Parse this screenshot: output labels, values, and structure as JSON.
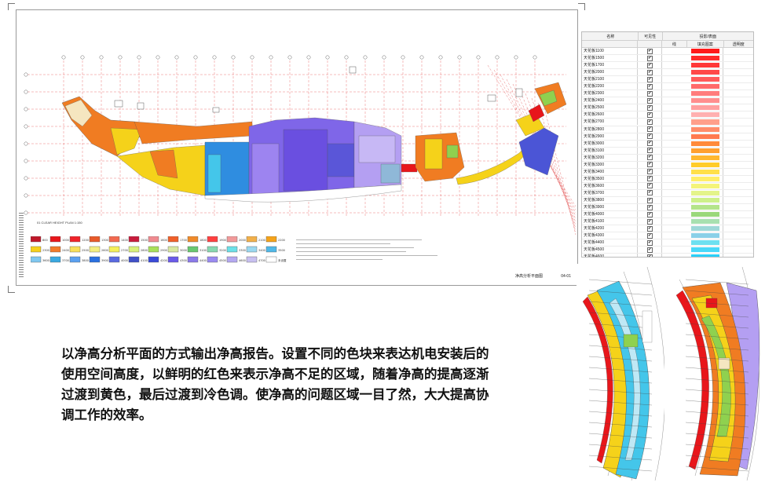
{
  "sheet": {
    "sub_title": "01 CLEAR HEIGHT PLAN 1:150",
    "title": "净高分析平面图",
    "number": "04-01"
  },
  "plan_colors": {
    "red": "#e8161b",
    "orange": "#f07c22",
    "yellow": "#f5d21a",
    "green": "#8fd14f",
    "cyan": "#44c6ea",
    "blue": "#2f6fe0",
    "indigo": "#4b55d6",
    "violet": "#7f66e8",
    "lavender": "#b49ff2"
  },
  "legend_swatches": [
    {
      "color": "#c0182a",
      "label": "800"
    },
    {
      "color": "#e8161b",
      "label": "1000"
    },
    {
      "color": "#f0242a",
      "label": "1200"
    },
    {
      "color": "#e85a2a",
      "label": "1300"
    },
    {
      "color": "#f26a50",
      "label": "1400"
    },
    {
      "color": "#c81c3c",
      "label": "1500"
    },
    {
      "color": "#f08a90",
      "label": "1600"
    },
    {
      "color": "#f0602a",
      "label": "1700"
    },
    {
      "color": "#f08a2a",
      "label": "1800"
    },
    {
      "color": "#ff4040",
      "label": "1900"
    },
    {
      "color": "#f29a9a",
      "label": "2000"
    },
    {
      "color": "#f2b04a",
      "label": "2100"
    },
    {
      "color": "#f5a31a",
      "label": "2200"
    },
    {
      "color": "#f7d01c",
      "label": "2300"
    },
    {
      "color": "#f27a2a",
      "label": "2400"
    },
    {
      "color": "#f8e05a",
      "label": "2500"
    },
    {
      "color": "#f3ee80",
      "label": "2600"
    },
    {
      "color": "#f5f05a",
      "label": "2700"
    },
    {
      "color": "#d8f07a",
      "label": "2800"
    },
    {
      "color": "#a8e05a",
      "label": "2900"
    },
    {
      "color": "#d8e8a0",
      "label": "3000"
    },
    {
      "color": "#68c870",
      "label": "3100"
    },
    {
      "color": "#88d8b0",
      "label": "3200"
    },
    {
      "color": "#6ce0e8",
      "label": "3300"
    },
    {
      "color": "#9ad8f0",
      "label": "3400"
    },
    {
      "color": "#50b8e8",
      "label": "3500"
    },
    {
      "color": "#80c8f0",
      "label": "3600"
    },
    {
      "color": "#3aa8e0",
      "label": "3700"
    },
    {
      "color": "#5aa0f0",
      "label": "3800"
    },
    {
      "color": "#2a70e0",
      "label": "3900"
    },
    {
      "color": "#5a6ae0",
      "label": "4000"
    },
    {
      "color": "#4050c8",
      "label": "4100"
    },
    {
      "color": "#3a4ad8",
      "label": "4200"
    },
    {
      "color": "#6a5ae8",
      "label": "4300"
    },
    {
      "color": "#8a7ae8",
      "label": "4400"
    },
    {
      "color": "#9a8af0",
      "label": "4500"
    },
    {
      "color": "#b4a8f0",
      "label": "4600"
    },
    {
      "color": "#c8c0f0",
      "label": "4700"
    },
    {
      "color": "#ffffff",
      "label": "未设置"
    }
  ],
  "view_graphics": {
    "headers": {
      "name": "名称",
      "visible": "可见性",
      "group": "投影/表面",
      "line": "线",
      "fill": "填充图案",
      "transparency": "透明度"
    },
    "rows": [
      {
        "name": "天花板1100",
        "visible": true,
        "color": "#ff1a1a"
      },
      {
        "name": "天花板1500",
        "visible": true,
        "color": "#ff2a2a"
      },
      {
        "name": "天花板1700",
        "visible": true,
        "color": "#ff3838"
      },
      {
        "name": "天花板2000",
        "visible": true,
        "color": "#ff4848"
      },
      {
        "name": "天花板2100",
        "visible": true,
        "color": "#ff5a5a"
      },
      {
        "name": "天花板2200",
        "visible": true,
        "color": "#ff6a6a"
      },
      {
        "name": "天花板2300",
        "visible": true,
        "color": "#ff7c7c"
      },
      {
        "name": "天花板2400",
        "visible": true,
        "color": "#ff8e8e"
      },
      {
        "name": "天花板2500",
        "visible": true,
        "color": "#ffa0a0"
      },
      {
        "name": "天花板2600",
        "visible": true,
        "color": "#ffb0b0"
      },
      {
        "name": "天花板2700",
        "visible": true,
        "color": "#ff9f8a"
      },
      {
        "name": "天花板2800",
        "visible": true,
        "color": "#ff8c6a"
      },
      {
        "name": "天花板2900",
        "visible": true,
        "color": "#ff7a50"
      },
      {
        "name": "天花板3000",
        "visible": true,
        "color": "#ff8a3a"
      },
      {
        "name": "天花板3100",
        "visible": true,
        "color": "#ffa030"
      },
      {
        "name": "天花板3200",
        "visible": true,
        "color": "#ffb830"
      },
      {
        "name": "天花板3300",
        "visible": true,
        "color": "#ffcc2a"
      },
      {
        "name": "天花板3400",
        "visible": true,
        "color": "#ffe04a"
      },
      {
        "name": "天花板3500",
        "visible": true,
        "color": "#ffee6a"
      },
      {
        "name": "天花板3600",
        "visible": true,
        "color": "#f4f47a"
      },
      {
        "name": "天花板3700",
        "visible": true,
        "color": "#e4f48a"
      },
      {
        "name": "天花板3800",
        "visible": true,
        "color": "#cef08a"
      },
      {
        "name": "天花板3900",
        "visible": true,
        "color": "#b4e48a"
      },
      {
        "name": "天花板4000",
        "visible": true,
        "color": "#9ad87a"
      },
      {
        "name": "天花板4100",
        "visible": true,
        "color": "#a8e0b0"
      },
      {
        "name": "天花板4200",
        "visible": true,
        "color": "#9ed8d8"
      },
      {
        "name": "天花板4300",
        "visible": true,
        "color": "#8ad0e8"
      },
      {
        "name": "天花板4400",
        "visible": true,
        "color": "#6ee0f0"
      },
      {
        "name": "天花板4500",
        "visible": true,
        "color": "#4ad8f8"
      },
      {
        "name": "天花板4600",
        "visible": true,
        "color": "#2ad0f8"
      },
      {
        "name": "天花板4700",
        "visible": true,
        "color": "#1ac0f0"
      },
      {
        "name": "天花板4800",
        "visible": true,
        "color": "#14aee8"
      },
      {
        "name": "天花板4900",
        "visible": true,
        "color": "#1096d8"
      },
      {
        "name": "天花板5000",
        "visible": true,
        "color": "#0a7ec8"
      }
    ]
  },
  "description": "以净高分析平面的方式输出净高报告。设置不同的色块来表达机电安装后的使用空间高度，以鲜明的红色来表示净高不足的区域，随着净高的提高逐渐过渡到黄色，最后过渡到冷色调。使净高的问题区域一目了然，大大提高协调工作的效率。"
}
